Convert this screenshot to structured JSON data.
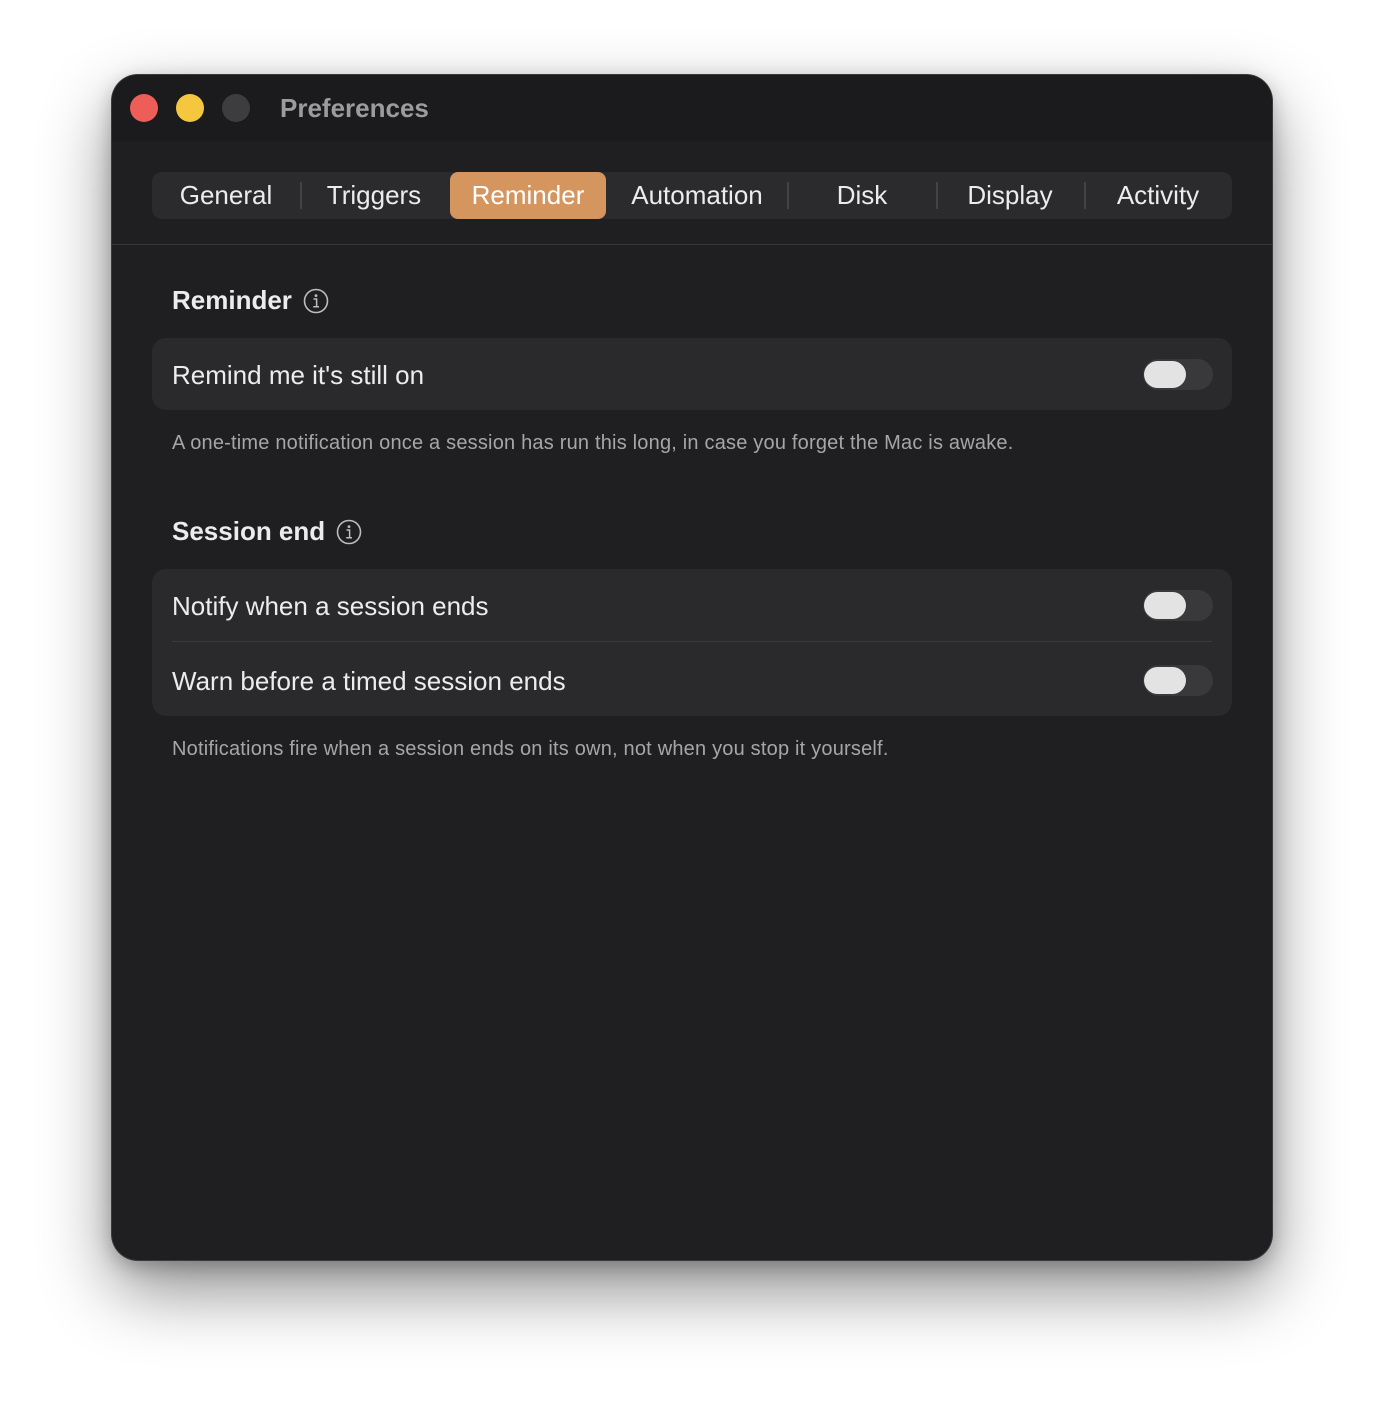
{
  "window": {
    "title": "Preferences"
  },
  "tabs": [
    {
      "label": "General"
    },
    {
      "label": "Triggers"
    },
    {
      "label": "Reminder"
    },
    {
      "label": "Automation"
    },
    {
      "label": "Disk"
    },
    {
      "label": "Display"
    },
    {
      "label": "Activity"
    }
  ],
  "active_tab": "Reminder",
  "reminder_section": {
    "title": "Reminder",
    "info_icon": "info-circle",
    "toggle_label": "Remind me it's still on",
    "toggle_on": false,
    "caption": "A one-time notification once a session has run this long, in case you forget the Mac is awake."
  },
  "session_end_section": {
    "title": "Session end",
    "info_icon": "info-circle",
    "rows": [
      {
        "label": "Notify when a session ends",
        "toggle_on": false
      },
      {
        "label": "Warn before a timed session ends",
        "toggle_on": false
      }
    ],
    "caption": "Notifications fire when a session ends on its own, not when you stop it yourself."
  },
  "colors": {
    "accent": "#d4955f",
    "window_bg": "#1f1f21",
    "card_bg": "#2a2a2c",
    "close": "#ee5e58",
    "minimize": "#f5c73e"
  }
}
